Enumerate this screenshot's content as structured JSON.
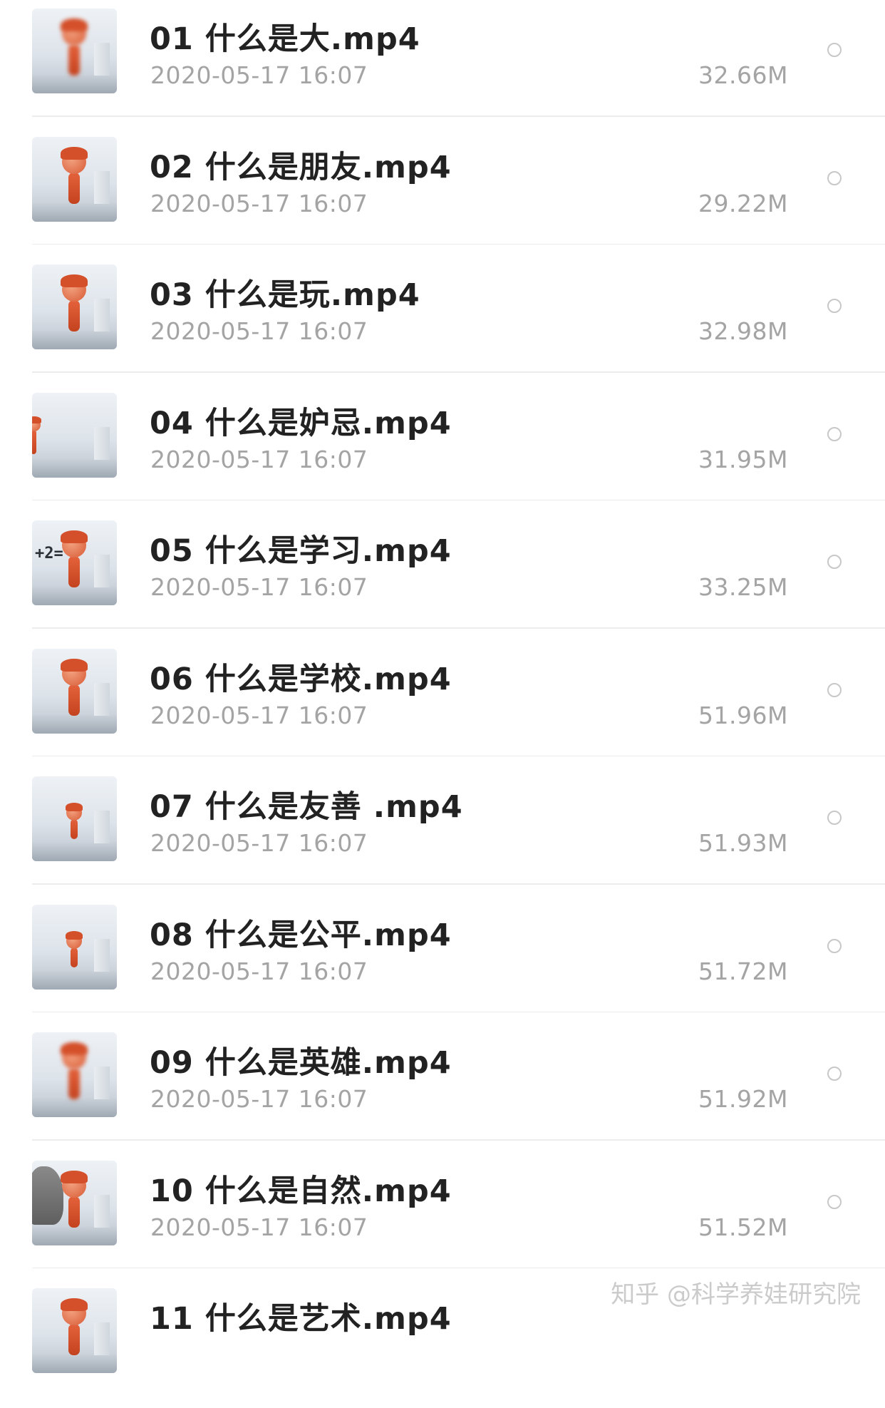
{
  "files": [
    {
      "name": "01 什么是大.mp4",
      "date": "2020-05-17 16:07",
      "size": "32.66M",
      "thumb": "blur"
    },
    {
      "name": "02 什么是朋友.mp4",
      "date": "2020-05-17 16:07",
      "size": "29.22M",
      "thumb": "normal"
    },
    {
      "name": "03 什么是玩.mp4",
      "date": "2020-05-17 16:07",
      "size": "32.98M",
      "thumb": "normal"
    },
    {
      "name": "04 什么是妒忌.mp4",
      "date": "2020-05-17 16:07",
      "size": "31.95M",
      "thumb": "edge"
    },
    {
      "name": "05 什么是学习.mp4",
      "date": "2020-05-17 16:07",
      "size": "33.25M",
      "thumb": "chalk"
    },
    {
      "name": "06 什么是学校.mp4",
      "date": "2020-05-17 16:07",
      "size": "51.96M",
      "thumb": "normal"
    },
    {
      "name": "07 什么是友善 .mp4",
      "date": "2020-05-17 16:07",
      "size": "51.93M",
      "thumb": "small"
    },
    {
      "name": "08 什么是公平.mp4",
      "date": "2020-05-17 16:07",
      "size": "51.72M",
      "thumb": "small"
    },
    {
      "name": "09 什么是英雄.mp4",
      "date": "2020-05-17 16:07",
      "size": "51.92M",
      "thumb": "blur"
    },
    {
      "name": "10 什么是自然.mp4",
      "date": "2020-05-17 16:07",
      "size": "51.52M",
      "thumb": "elephant"
    },
    {
      "name": "11 什么是艺术.mp4",
      "date": "",
      "size": "",
      "thumb": "normal"
    }
  ],
  "chalk_text": "+2=",
  "watermark": "知乎 @科学养娃研究院",
  "colors": {
    "title": "#222222",
    "meta": "#a4a4a4",
    "divider": "#ececec",
    "radio": "#c8c8c8"
  },
  "icons": {
    "select": "radio-circle-icon",
    "thumbnail": "video-thumbnail"
  }
}
